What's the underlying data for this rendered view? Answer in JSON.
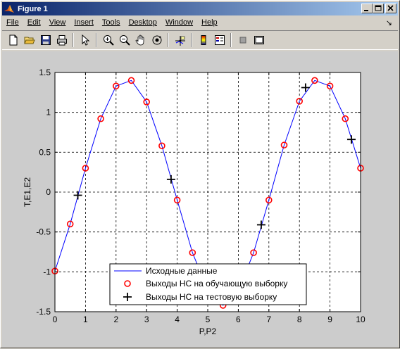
{
  "window": {
    "title": "Figure 1",
    "colors": {
      "titlebar_start": "#0a246a",
      "titlebar_end": "#a6caf0",
      "chrome": "#d4d0c8",
      "figure_bg": "#cccccc"
    }
  },
  "menubar": {
    "items": [
      {
        "label": "File"
      },
      {
        "label": "Edit"
      },
      {
        "label": "View"
      },
      {
        "label": "Insert"
      },
      {
        "label": "Tools"
      },
      {
        "label": "Desktop"
      },
      {
        "label": "Window"
      },
      {
        "label": "Help"
      }
    ],
    "dock_arrow": "↘"
  },
  "toolbar": {
    "icons": [
      "new-figure-icon",
      "open-file-icon",
      "save-icon",
      "print-icon",
      "pointer-icon",
      "zoom-in-icon",
      "zoom-out-icon",
      "pan-hand-icon",
      "rotate-3d-icon",
      "data-cursor-icon",
      "colorbar-icon",
      "legend-icon",
      "hide-plot-tools-icon",
      "show-plot-tools-icon"
    ]
  },
  "chart_data": {
    "type": "line",
    "xlabel": "P,P2",
    "ylabel": "T,E1,E2",
    "xlim": [
      0,
      10
    ],
    "ylim": [
      -1.5,
      1.5
    ],
    "xticks": [
      "0",
      "1",
      "2",
      "3",
      "4",
      "5",
      "6",
      "7",
      "8",
      "9",
      "10"
    ],
    "yticks": [
      "1.5",
      "1",
      "0.5",
      "0",
      "-0.5",
      "-1",
      "-1.5"
    ],
    "grid": true,
    "legend_position": "bottom",
    "series": [
      {
        "name": "Исходные данные",
        "style": "line",
        "color": "#0000ff",
        "x": [
          0,
          0.5,
          1,
          1.5,
          2,
          2.5,
          3,
          3.5,
          4,
          4.5,
          5,
          5.5,
          6,
          6.5,
          7,
          7.5,
          8,
          8.5,
          9,
          9.5,
          10
        ],
        "y": [
          -0.99,
          -0.4,
          0.3,
          0.92,
          1.33,
          1.4,
          1.13,
          0.58,
          -0.1,
          -0.76,
          -1.23,
          -1.42,
          -1.24,
          -0.76,
          -0.1,
          0.59,
          1.14,
          1.4,
          1.33,
          0.92,
          0.3
        ]
      },
      {
        "name": "Выходы НС на обучающую выборку",
        "style": "circle",
        "color": "#ff0000",
        "x": [
          0,
          0.5,
          1,
          1.5,
          2,
          2.5,
          3,
          3.5,
          4,
          4.5,
          5,
          5.5,
          6,
          6.5,
          7,
          7.5,
          8,
          8.5,
          9,
          9.5,
          10
        ],
        "y": [
          -0.99,
          -0.4,
          0.3,
          0.92,
          1.33,
          1.4,
          1.13,
          0.58,
          -0.1,
          -0.76,
          -1.23,
          -1.42,
          -1.24,
          -0.76,
          -0.1,
          0.59,
          1.14,
          1.4,
          1.33,
          0.92,
          0.3
        ]
      },
      {
        "name": "Выходы НС на тестовую выборку",
        "style": "plus",
        "color": "#000000",
        "x": [
          0.75,
          3.8,
          6.75,
          8.2,
          9.7
        ],
        "y": [
          -0.04,
          0.16,
          -0.41,
          1.31,
          0.66
        ]
      }
    ]
  }
}
